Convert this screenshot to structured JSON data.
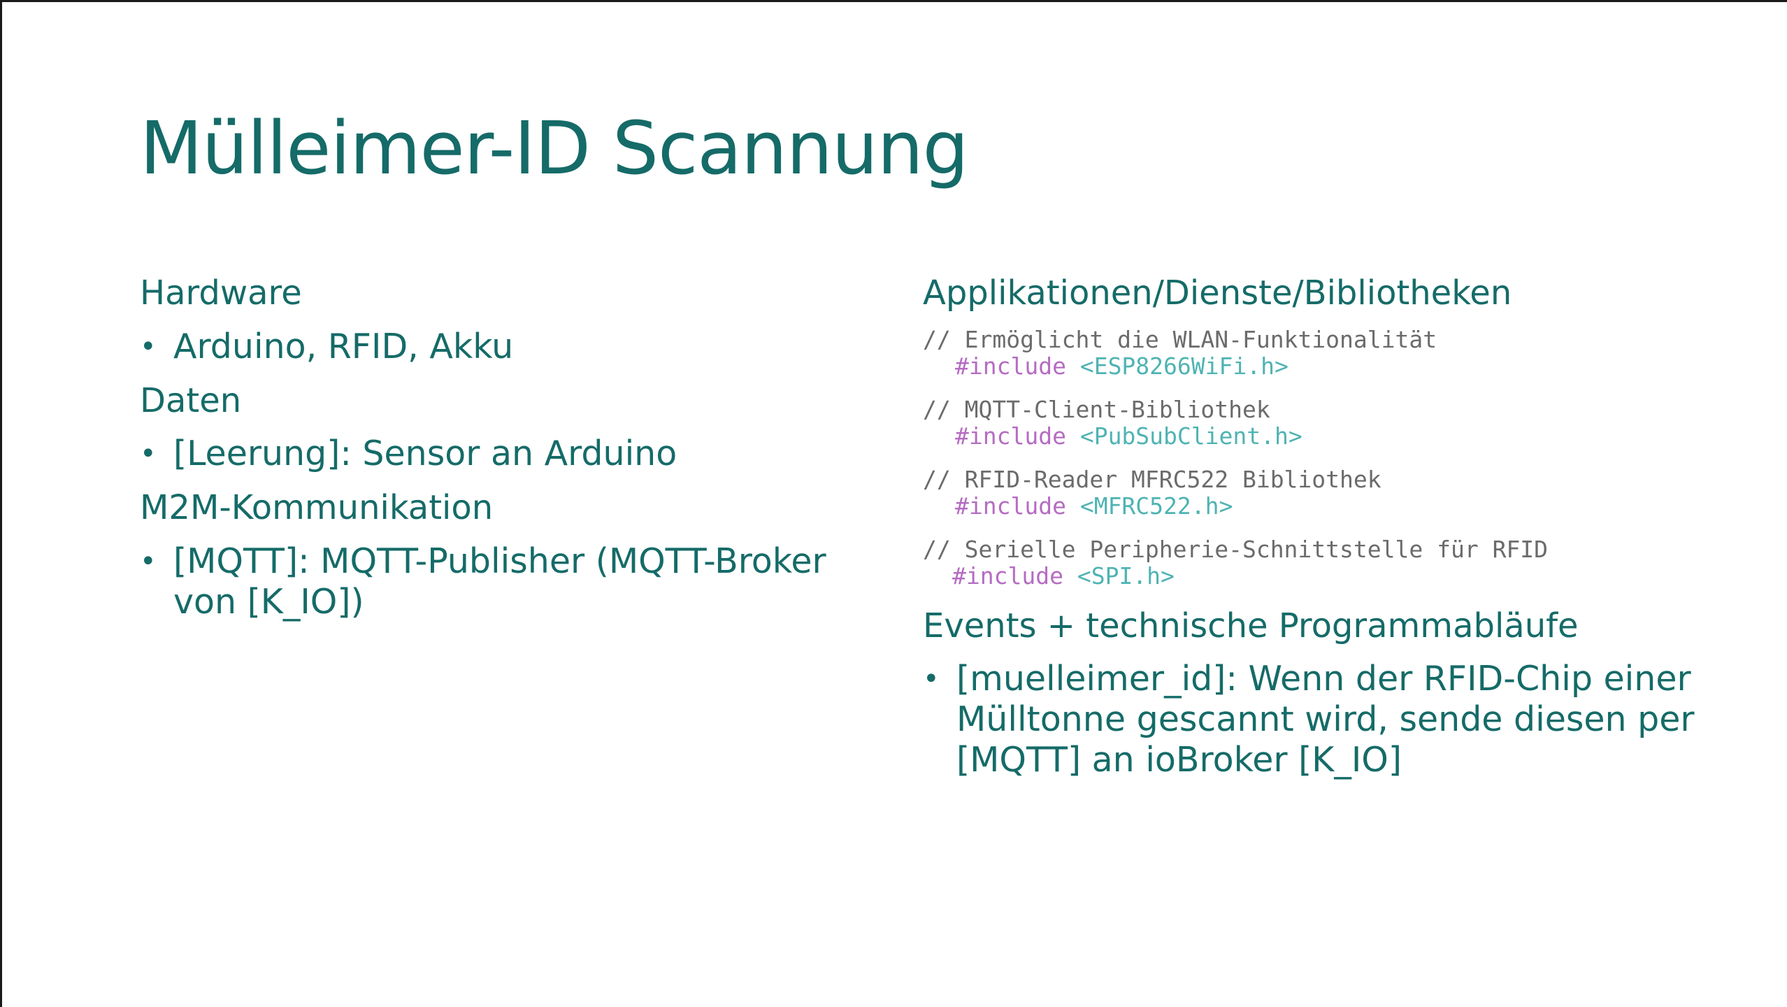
{
  "slide": {
    "title": "Mülleimer-ID Scannung"
  },
  "left_column": {
    "sections": [
      {
        "heading": "Hardware",
        "bullets": [
          "Arduino, RFID, Akku"
        ]
      },
      {
        "heading": "Daten",
        "bullets": [
          "[Leerung]: Sensor an Arduino"
        ]
      },
      {
        "heading": "M2M-Kommunikation",
        "bullets": [
          "[MQTT]: MQTT-Publisher (MQTT-Broker von [K_IO])"
        ]
      }
    ]
  },
  "right_column": {
    "apps_heading": "Applikationen/Dienste/Bibliotheken",
    "code": [
      {
        "comment": "// Ermöglicht die WLAN-Funktionalität",
        "keyword": "#include",
        "header": "<ESP8266WiFi.h>"
      },
      {
        "comment": "// MQTT-Client-Bibliothek",
        "keyword": "#include",
        "header": "<PubSubClient.h>"
      },
      {
        "comment": "// RFID-Reader MFRC522 Bibliothek",
        "keyword": "#include",
        "header": "<MFRC522.h>"
      },
      {
        "comment": "// Serielle Peripherie-Schnittstelle für RFID",
        "keyword": "#include",
        "header": "<SPI.h>"
      }
    ],
    "events_heading": "Events + technische Programmabläufe",
    "events_bullets": [
      "[muelleimer_id]: Wenn der RFID-Chip einer Mülltonne gescannt wird, sende diesen per [MQTT] an ioBroker [K_IO]"
    ]
  },
  "colors": {
    "text_teal": "#156b68",
    "code_comment": "#6b6b6b",
    "code_keyword": "#b56cc2",
    "code_header": "#4fb3b3"
  },
  "bullet_glyph": "•"
}
